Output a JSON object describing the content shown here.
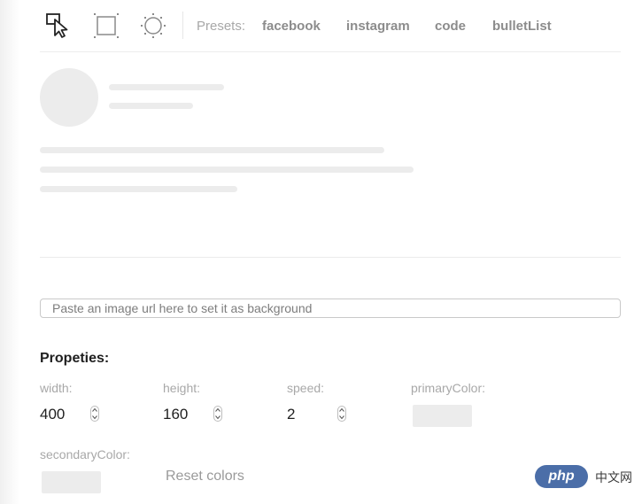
{
  "toolbar": {
    "tools": [
      {
        "icon": "cursor-select-icon"
      },
      {
        "icon": "rectangle-tool-icon"
      },
      {
        "icon": "circle-tool-icon"
      }
    ],
    "presets_label": "Presets:",
    "presets": [
      "facebook",
      "instagram",
      "code",
      "bulletList"
    ]
  },
  "background_input": {
    "placeholder": "Paste an image url here to set it as background",
    "value": ""
  },
  "properties": {
    "title": "Propeties:",
    "width": {
      "label": "width:",
      "value": "400"
    },
    "height": {
      "label": "height:",
      "value": "160"
    },
    "speed": {
      "label": "speed:",
      "value": "2"
    },
    "primaryColor": {
      "label": "primaryColor:",
      "color": "#ececec"
    },
    "secondaryColor": {
      "label": "secondaryColor:",
      "color": "#ececec"
    },
    "reset_label": "Reset colors"
  },
  "watermark": {
    "logo_text": "php",
    "text": "中文网"
  },
  "colors": {
    "skeleton": "#ececec",
    "preset_text": "#8c8c8c",
    "label_text": "#a8a8a8",
    "watermark_bg": "#4b6ea8"
  }
}
